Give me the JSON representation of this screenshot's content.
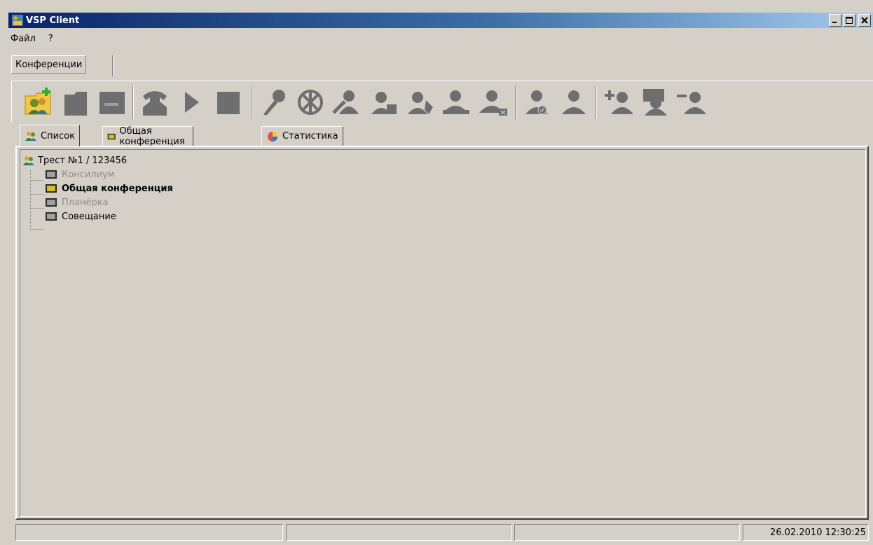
{
  "window": {
    "title": "VSP Client",
    "controls": [
      "_",
      "□",
      "X"
    ]
  },
  "menu": {
    "items": [
      "Файл",
      "?"
    ]
  },
  "conference_tab": "Конференции",
  "toolbar": {
    "buttons": [
      "add-conference-icon",
      "delete-conference-icon",
      "keyboard-icon",
      "phone-icon",
      "play-icon",
      "stop-icon",
      "microphone-icon",
      "ban-icon",
      "camera-user-icon",
      "user-speak-icon",
      "user-hand-icon",
      "user-screen-icon",
      "user-remove-screen-icon",
      "user-check-icon",
      "user-icon",
      "add-user-icon",
      "user-chat-icon",
      "remove-user-icon"
    ]
  },
  "tabs": [
    {
      "label": "Список",
      "icon": "users-icon",
      "active": true
    },
    {
      "label": "Общая конференция",
      "icon": "screen-icon",
      "active": false
    },
    {
      "label": "Статистика",
      "icon": "pie-chart-icon",
      "active": false
    }
  ],
  "tree": {
    "root": "Трест №1 / 123456",
    "items": [
      {
        "label": "Консилиум",
        "state": "disabled"
      },
      {
        "label": "Общая конференция",
        "state": "bold"
      },
      {
        "label": "Планёрка",
        "state": "disabled"
      },
      {
        "label": "Совещание",
        "state": "normal"
      }
    ]
  },
  "statusbar": {
    "cell1": "",
    "cell2": "",
    "cell3": "",
    "datetime": "26.02.2010 12:30:25"
  },
  "colors": {
    "title_start": "#0a246a",
    "title_end": "#a6caf0",
    "face": "#d4d0c8",
    "disabled_text": "#8c8a85",
    "icon_gray": "#6e6e6e"
  }
}
